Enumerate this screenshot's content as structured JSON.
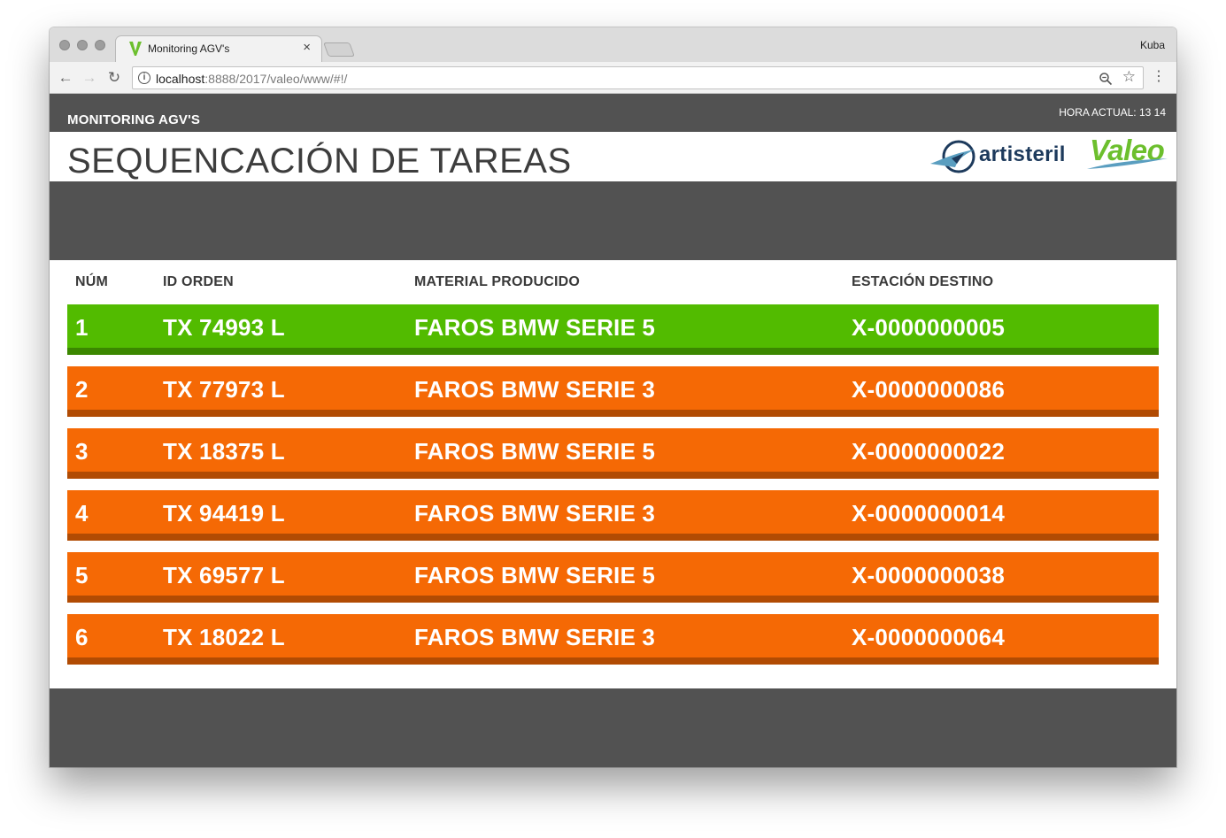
{
  "browser": {
    "tab_title": "Monitoring AGV's",
    "tab_close": "×",
    "profile_name": "Kuba",
    "url_host": "localhost",
    "url_rest": ":8888/2017/valeo/www/#!/",
    "icons": [
      "back-icon",
      "forward-icon",
      "reload-icon",
      "info-icon",
      "zoom-icon",
      "star-icon",
      "menu-icon"
    ]
  },
  "app": {
    "title": "MONITORING AGV'S",
    "clock": "HORA ACTUAL: 13 14",
    "page_title": "SEQUENCACIÓN DE TAREAS",
    "logos": {
      "artisteril": "artisteril",
      "valeo": "Valeo"
    }
  },
  "table": {
    "headers": [
      "NÚM",
      "ID ORDEN",
      "MATERIAL PRODUCIDO",
      "ESTACIÓN DESTINO"
    ],
    "rows": [
      {
        "num": "1",
        "id": "TX 74993 L",
        "material": "FAROS BMW SERIE 5",
        "station": "X-0000000005",
        "status": "active"
      },
      {
        "num": "2",
        "id": "TX 77973 L",
        "material": "FAROS BMW SERIE 3",
        "station": "X-0000000086",
        "status": "pending"
      },
      {
        "num": "3",
        "id": "TX 18375 L",
        "material": "FAROS BMW SERIE 5",
        "station": "X-0000000022",
        "status": "pending"
      },
      {
        "num": "4",
        "id": "TX 94419 L",
        "material": "FAROS BMW SERIE 3",
        "station": "X-0000000014",
        "status": "pending"
      },
      {
        "num": "5",
        "id": "TX 69577 L",
        "material": "FAROS BMW SERIE 5",
        "station": "X-0000000038",
        "status": "pending"
      },
      {
        "num": "6",
        "id": "TX 18022 L",
        "material": "FAROS BMW SERIE 3",
        "station": "X-0000000064",
        "status": "pending"
      }
    ]
  },
  "colors": {
    "active": "#52bb00",
    "pending": "#f56905",
    "dark_bg": "#525252",
    "valeo_green": "#6cbf2d",
    "artisteril_blue": "#1d3a5c"
  }
}
